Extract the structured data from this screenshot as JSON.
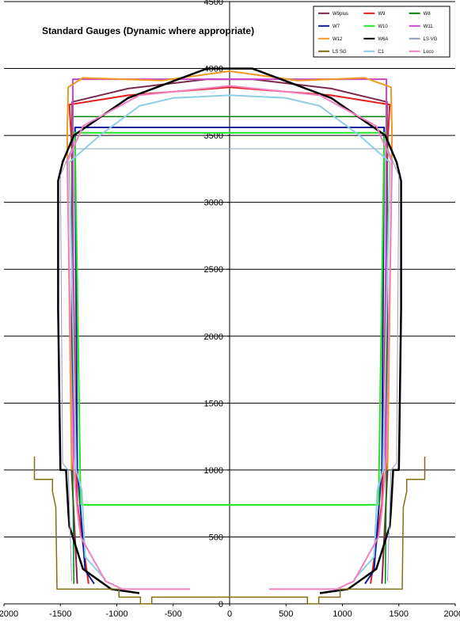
{
  "chart_data": {
    "type": "line",
    "title": "Standard Gauges (Dynamic where appropriate)",
    "xlabel": "",
    "ylabel": "",
    "xlim": [
      -2000,
      2000
    ],
    "ylim": [
      0,
      4500
    ],
    "x_ticks": [
      -2000,
      -1500,
      -1000,
      -500,
      0,
      500,
      1000,
      1500,
      2000
    ],
    "x_tick_labels": [
      "-2000",
      "-1500",
      "-1000",
      "-500",
      "0",
      "500",
      "1000",
      "1500",
      "2000"
    ],
    "y_ticks": [
      0,
      500,
      1000,
      1500,
      2000,
      2500,
      3000,
      3500,
      4000,
      4500
    ],
    "y_tick_labels": [
      "0",
      "500",
      "1000",
      "1500",
      "2000",
      "2500",
      "3000",
      "3500",
      "4000",
      "4500"
    ],
    "grid": "horizontal",
    "legend_position": "top-right",
    "series": [
      {
        "name": "W9plus",
        "color": "#7b2a4e",
        "width": 2,
        "points": [
          [
            -1350,
            150
          ],
          [
            -1400,
            1000
          ],
          [
            -1395,
            3750
          ],
          [
            -900,
            3850
          ],
          [
            -200,
            3920
          ],
          [
            200,
            3920
          ],
          [
            900,
            3850
          ],
          [
            1395,
            3750
          ],
          [
            1400,
            1000
          ],
          [
            1350,
            150
          ]
        ]
      },
      {
        "name": "W9",
        "color": "#e3201f",
        "width": 2,
        "points": [
          [
            -1250,
            150
          ],
          [
            -1350,
            750
          ],
          [
            -1360,
            1000
          ],
          [
            -1400,
            3440
          ],
          [
            -1420,
            3730
          ],
          [
            -900,
            3800
          ],
          [
            0,
            3860
          ],
          [
            900,
            3800
          ],
          [
            1420,
            3730
          ],
          [
            1400,
            3440
          ],
          [
            1360,
            1000
          ],
          [
            1350,
            750
          ],
          [
            1250,
            150
          ]
        ]
      },
      {
        "name": "W8",
        "color": "#008000",
        "width": 1.5,
        "points": [
          [
            -1380,
            150
          ],
          [
            -1390,
            1000
          ],
          [
            -1395,
            3640
          ],
          [
            1395,
            3640
          ],
          [
            1390,
            1000
          ],
          [
            1380,
            150
          ]
        ]
      },
      {
        "name": "W7",
        "color": "#0a1f9c",
        "width": 2,
        "points": [
          [
            -1200,
            150
          ],
          [
            -1280,
            250
          ],
          [
            -1340,
            900
          ],
          [
            -1350,
            1000
          ],
          [
            -1370,
            3450
          ],
          [
            -1370,
            3560
          ],
          [
            1370,
            3560
          ],
          [
            1370,
            3450
          ],
          [
            1350,
            1000
          ],
          [
            1340,
            900
          ],
          [
            1280,
            250
          ],
          [
            1200,
            150
          ]
        ]
      },
      {
        "name": "W10",
        "color": "#22e622",
        "width": 2,
        "points": [
          [
            -1320,
            740
          ],
          [
            -1370,
            3460
          ],
          [
            -1380,
            3520
          ],
          [
            1380,
            3520
          ],
          [
            1370,
            3460
          ],
          [
            1320,
            740
          ],
          [
            -1320,
            740
          ]
        ]
      },
      {
        "name": "W11",
        "color": "#cc44cc",
        "width": 2,
        "points": [
          [
            -1380,
            1000
          ],
          [
            -1390,
            3920
          ],
          [
            1390,
            3920
          ],
          [
            1380,
            1000
          ]
        ]
      },
      {
        "name": "W12",
        "color": "#ee9922",
        "width": 2,
        "points": [
          [
            -1400,
            1000
          ],
          [
            -1440,
            3500
          ],
          [
            -1430,
            3860
          ],
          [
            -1300,
            3930
          ],
          [
            -600,
            3910
          ],
          [
            0,
            3980
          ],
          [
            600,
            3910
          ],
          [
            1200,
            3930
          ],
          [
            1430,
            3860
          ],
          [
            1440,
            3500
          ],
          [
            1400,
            1000
          ]
        ]
      },
      {
        "name": "W6A",
        "color": "#000000",
        "width": 2.5,
        "points": [
          [
            -800,
            80
          ],
          [
            -1050,
            110
          ],
          [
            -1300,
            260
          ],
          [
            -1420,
            580
          ],
          [
            -1430,
            700
          ],
          [
            -1450,
            1000
          ],
          [
            -1500,
            1000
          ],
          [
            -1520,
            2200
          ],
          [
            -1520,
            3160
          ],
          [
            -1480,
            3300
          ],
          [
            -1380,
            3500
          ],
          [
            -900,
            3780
          ],
          [
            -200,
            4000
          ],
          [
            200,
            4000
          ],
          [
            900,
            3780
          ],
          [
            1380,
            3500
          ],
          [
            1480,
            3300
          ],
          [
            1520,
            3160
          ],
          [
            1520,
            2200
          ],
          [
            1500,
            1000
          ],
          [
            1450,
            1000
          ],
          [
            1430,
            700
          ],
          [
            1420,
            580
          ],
          [
            1300,
            260
          ],
          [
            1050,
            110
          ],
          [
            800,
            80
          ]
        ]
      },
      {
        "name": "LS VG",
        "color": "#8fa0b8",
        "width": 1,
        "points": [
          [
            -1400,
            170
          ],
          [
            -1430,
            1000
          ],
          [
            -1480,
            1050
          ],
          [
            -1500,
            3200
          ],
          [
            -1400,
            3400
          ],
          [
            1400,
            3400
          ],
          [
            1500,
            3200
          ],
          [
            1480,
            1050
          ],
          [
            1430,
            1000
          ],
          [
            1400,
            170
          ]
        ]
      },
      {
        "name": "LS SG",
        "color": "#7f6f10",
        "width": 1.5,
        "points": [
          [
            -1730,
            1100
          ],
          [
            -1730,
            930
          ],
          [
            -1570,
            930
          ],
          [
            -1570,
            840
          ],
          [
            -1540,
            720
          ],
          [
            -1530,
            110
          ],
          [
            -980,
            110
          ],
          [
            -980,
            50
          ],
          [
            -790,
            50
          ],
          [
            -790,
            0
          ],
          [
            -690,
            0
          ],
          [
            -690,
            50
          ],
          [
            690,
            50
          ],
          [
            690,
            0
          ],
          [
            790,
            0
          ],
          [
            790,
            50
          ],
          [
            980,
            50
          ],
          [
            980,
            110
          ],
          [
            1530,
            110
          ],
          [
            1540,
            720
          ],
          [
            1570,
            840
          ],
          [
            1570,
            930
          ],
          [
            1730,
            930
          ],
          [
            1730,
            1100
          ]
        ]
      },
      {
        "name": "C1",
        "color": "#8ecde8",
        "width": 2,
        "points": [
          [
            -1100,
            180
          ],
          [
            -1280,
            350
          ],
          [
            -1310,
            850
          ],
          [
            -1360,
            1000
          ],
          [
            -1420,
            3300
          ],
          [
            -1150,
            3500
          ],
          [
            -800,
            3720
          ],
          [
            -500,
            3780
          ],
          [
            0,
            3800
          ],
          [
            500,
            3780
          ],
          [
            800,
            3720
          ],
          [
            1150,
            3500
          ],
          [
            1420,
            3300
          ],
          [
            1360,
            1000
          ],
          [
            1310,
            850
          ],
          [
            1280,
            350
          ],
          [
            1100,
            180
          ]
        ]
      },
      {
        "name": "Loco",
        "color": "#f080c0",
        "width": 2,
        "points": [
          [
            -350,
            110
          ],
          [
            -950,
            110
          ],
          [
            -1100,
            170
          ],
          [
            -1320,
            500
          ],
          [
            -1350,
            700
          ],
          [
            -1390,
            1100
          ],
          [
            -1440,
            3300
          ],
          [
            -1300,
            3570
          ],
          [
            -800,
            3800
          ],
          [
            0,
            3870
          ],
          [
            800,
            3800
          ],
          [
            1300,
            3570
          ],
          [
            1440,
            3300
          ],
          [
            1390,
            1100
          ],
          [
            1350,
            700
          ],
          [
            1320,
            500
          ],
          [
            1100,
            170
          ],
          [
            950,
            110
          ],
          [
            350,
            110
          ]
        ]
      }
    ]
  }
}
